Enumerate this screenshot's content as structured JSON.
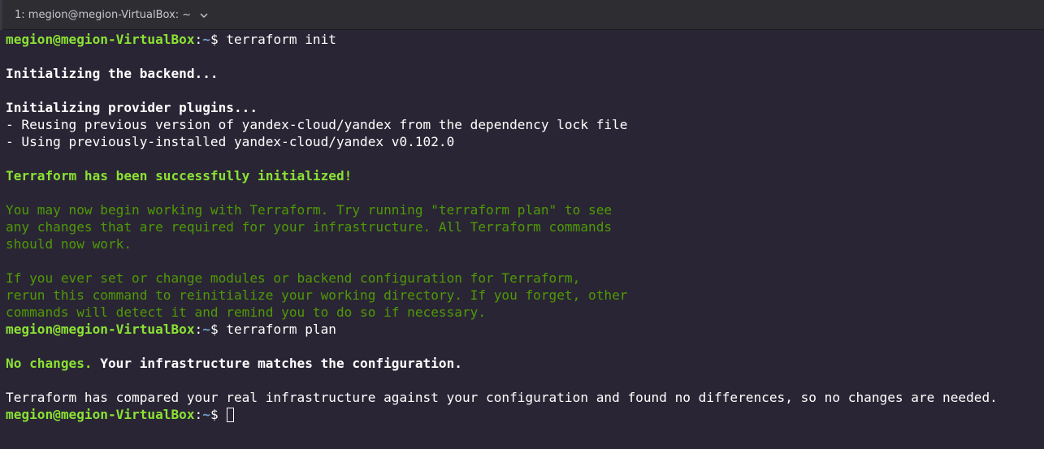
{
  "tab": {
    "title": "1: megion@megion-VirtualBox: ~",
    "dropdown_icon": "chevron-down-icon"
  },
  "prompt": {
    "user_host": "megion@megion-VirtualBox",
    "colon": ":",
    "path": "~",
    "symbol": "$ "
  },
  "commands": {
    "init": "terraform init",
    "plan": "terraform plan"
  },
  "init_output": {
    "backend": "Initializing the backend...",
    "plugins": "Initializing provider plugins...",
    "reuse": "- Reusing previous version of yandex-cloud/yandex from the dependency lock file",
    "using": "- Using previously-installed yandex-cloud/yandex v0.102.0",
    "success": "Terraform has been successfully initialized!",
    "info1": [
      "You may now begin working with Terraform. Try running \"terraform plan\" to see",
      "any changes that are required for your infrastructure. All Terraform commands",
      "should now work."
    ],
    "info2": [
      "If you ever set or change modules or backend configuration for Terraform,",
      "rerun this command to reinitialize your working directory. If you forget, other",
      "commands will detect it and remind you to do so if necessary."
    ]
  },
  "plan_output": {
    "no_changes": "No changes.",
    "matches": " Your infrastructure matches the configuration.",
    "compared": "Terraform has compared your real infrastructure against your configuration and found no differences, so no changes are needed."
  },
  "colors": {
    "prompt_user": "#8ae234",
    "prompt_path": "#729fcf",
    "info_green": "#4e9a06",
    "background": "#2a2534"
  }
}
